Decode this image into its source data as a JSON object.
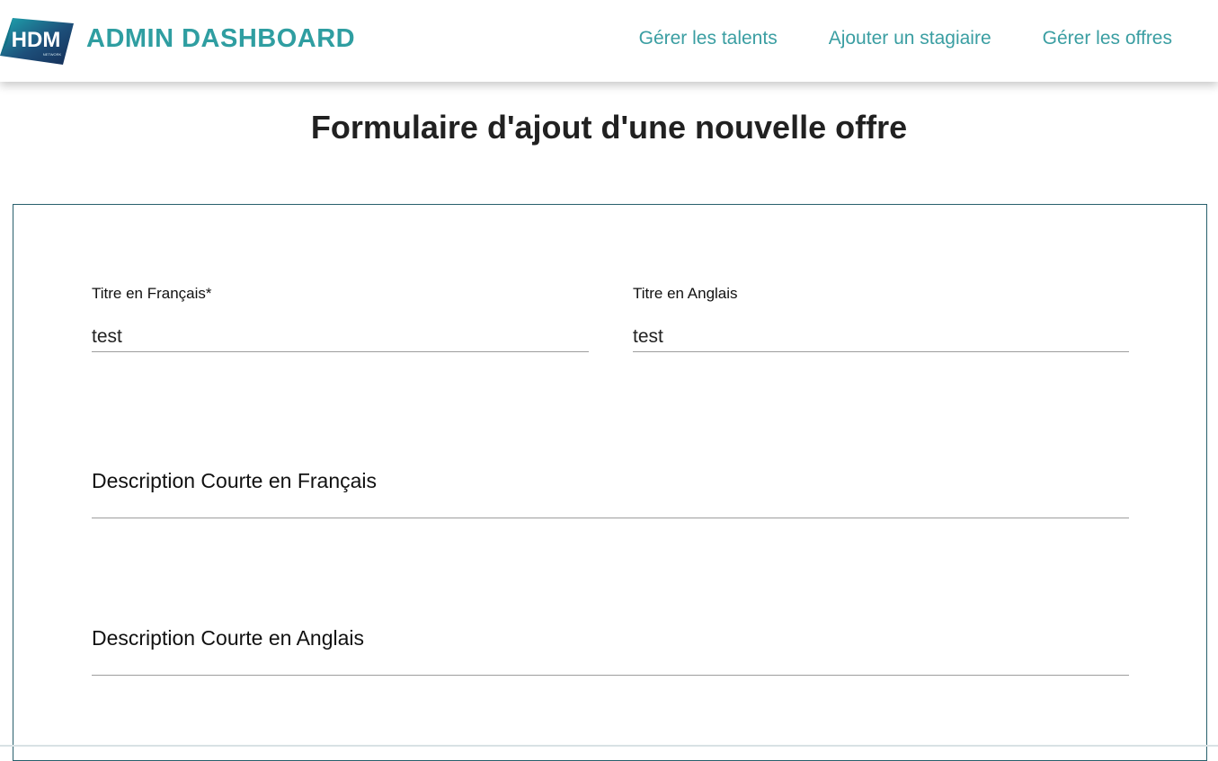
{
  "header": {
    "logo_text": "HDM",
    "logo_subtext": "NETWORK",
    "title": "ADMIN DASHBOARD",
    "nav": [
      {
        "label": "Gérer les talents"
      },
      {
        "label": "Ajouter un stagiaire"
      },
      {
        "label": "Gérer les offres"
      }
    ],
    "accent_color": "#2f9ea1"
  },
  "page": {
    "title": "Formulaire d'ajout d'une nouvelle offre"
  },
  "form": {
    "title_fr": {
      "label": "Titre en Français*",
      "value": "test"
    },
    "title_en": {
      "label": "Titre en Anglais",
      "value": "test"
    },
    "short_desc_fr": {
      "label": "Description Courte en Français",
      "value": ""
    },
    "short_desc_en": {
      "label": "Description Courte en Anglais",
      "value": ""
    }
  }
}
